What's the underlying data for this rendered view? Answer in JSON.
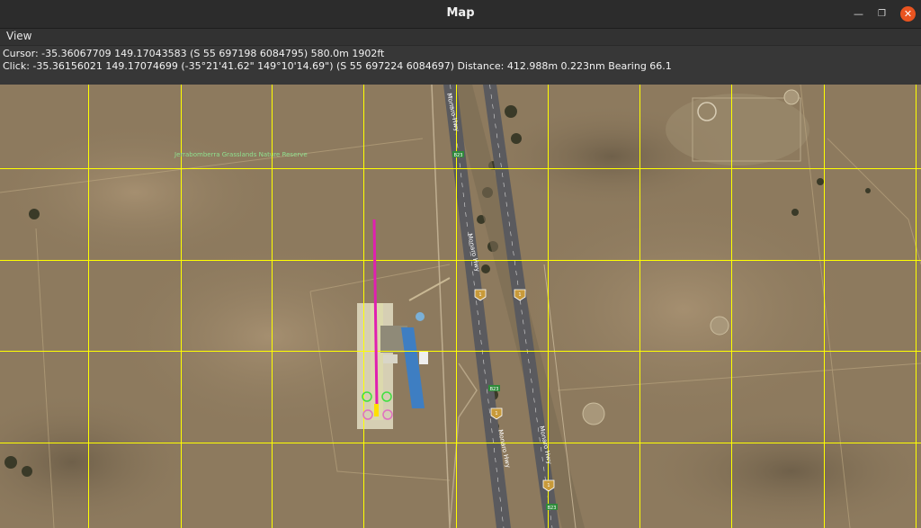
{
  "window": {
    "title": "Map",
    "minimize_icon": "minimize-icon",
    "maximize_icon": "restore-icon",
    "close_icon": "close-icon"
  },
  "menu": {
    "items": [
      {
        "label": "View"
      }
    ]
  },
  "status": {
    "cursor": "Cursor: -35.36067709 149.17043583 (S 55 697198 6084795) 580.0m 1902ft",
    "click": "Click: -35.36156021 149.17074699 (-35°21'41.62\" 149°10'14.69\") (S 55 697224 6084697)  Distance: 412.988m 0.223nm Bearing 66.1"
  },
  "map": {
    "labels": {
      "reserve": "Jerrabomberra Grasslands Nature Reserve",
      "highway": "Monaro Hwy",
      "route_shield": "B23",
      "route_number": "1"
    },
    "colors": {
      "grid": "#ffff00",
      "flight_path": "#e020b0",
      "waypoint_green": "#40e040",
      "waypoint_pink": "#e070c0",
      "terrain": "#8d7a5e",
      "road": "#5a5a5e"
    }
  }
}
